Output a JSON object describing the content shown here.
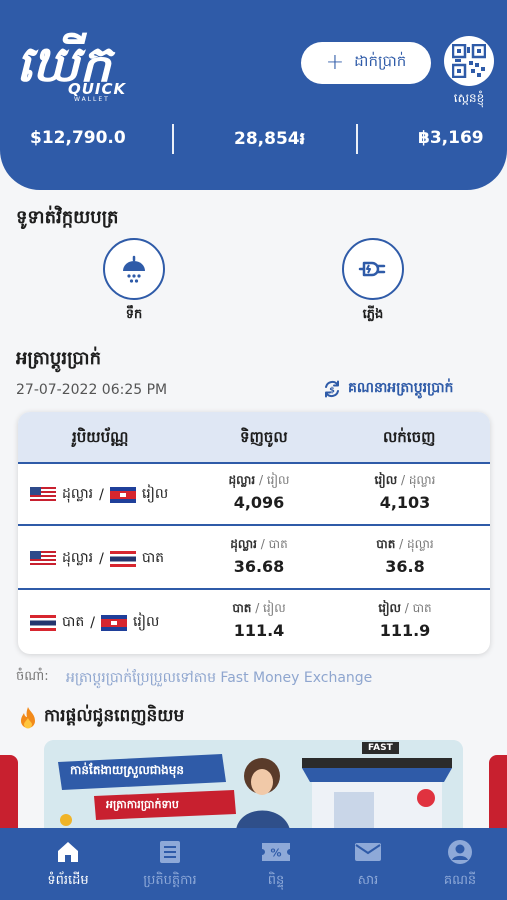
{
  "header": {
    "logo_main": "ឃើក",
    "logo_quick": "QUICK",
    "logo_wallet": "WALLET",
    "deposit_label": "ដាក់ប្រាក់",
    "qr_label": "ស្កេនខ្ញុំ",
    "balances": [
      "$12,790.0",
      "28,854៛",
      "฿3,169"
    ]
  },
  "bills": {
    "title": "ទូទាត់វិក្កយបត្រ",
    "items": [
      {
        "label": "ទឹក",
        "icon": "water-icon"
      },
      {
        "label": "ភ្លើង",
        "icon": "electricity-icon"
      }
    ]
  },
  "rates": {
    "title": "អត្រាប្តូរប្រាក់",
    "date": "27-07-2022 06:25 PM",
    "calc_label": "គណនាអត្រាប្តូរប្រាក់",
    "headers": [
      "រូបិយប័ណ្ណ",
      "ទិញចូល",
      "លក់ចេញ"
    ],
    "rows": [
      {
        "from": "ដុល្លារ",
        "to": "រៀល",
        "buy_from": "ដុល្លារ",
        "buy_to": "រៀល",
        "buy": "4,096",
        "sell_from": "រៀល",
        "sell_to": "ដុល្លារ",
        "sell": "4,103"
      },
      {
        "from": "ដុល្លារ",
        "to": "បាត",
        "buy_from": "ដុល្លារ",
        "buy_to": "បាត",
        "buy": "36.68",
        "sell_from": "បាត",
        "sell_to": "ដុល្លារ",
        "sell": "36.8"
      },
      {
        "from": "បាត",
        "to": "រៀល",
        "buy_from": "បាត",
        "buy_to": "រៀល",
        "buy": "111.4",
        "sell_from": "រៀល",
        "sell_to": "បាត",
        "sell": "111.9"
      }
    ],
    "note_label": "ចំណាំ:",
    "note_text": "អត្រាប្តូរប្រាក់ប្រែប្រួលទៅតាម Fast Money Exchange"
  },
  "promo": {
    "title": "ការផ្តល់ជូនពេញនិយម",
    "banner_headline": "កាន់តែងាយស្រួលជាងមុន",
    "banner_sub": "អត្រាការប្រាក់ទាប",
    "banner_brand": "FAST"
  },
  "nav": [
    {
      "label": "ទំព័រដើម",
      "icon": "home-icon",
      "active": true
    },
    {
      "label": "ប្រតិបត្តិការ",
      "icon": "receipt-icon",
      "active": false
    },
    {
      "label": "ពិន្ទុ",
      "icon": "coupon-icon",
      "active": false
    },
    {
      "label": "សារ",
      "icon": "mail-icon",
      "active": false
    },
    {
      "label": "គណនី",
      "icon": "account-icon",
      "active": false
    }
  ],
  "colors": {
    "primary": "#2f5ba8",
    "accent_red": "#c8202f"
  }
}
